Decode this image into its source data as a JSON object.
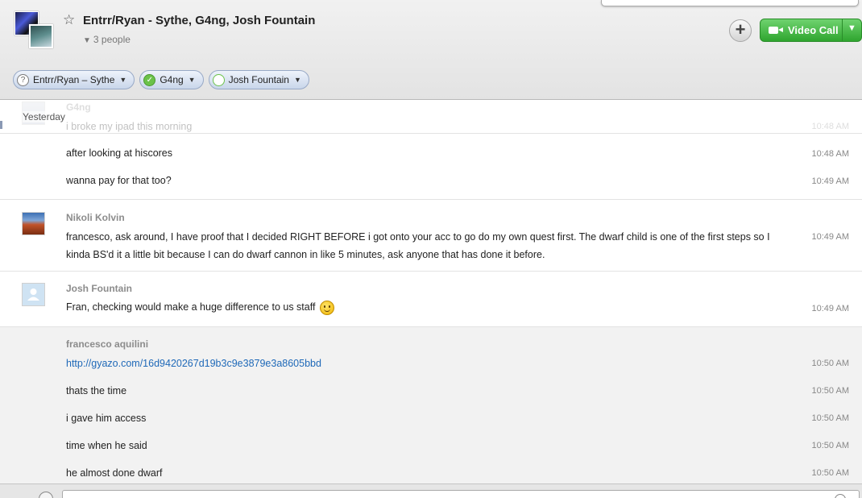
{
  "header": {
    "title": "Entrr/Ryan - Sythe, G4ng, Josh Fountain",
    "people_count": "3 people",
    "video_call_label": "Video Call",
    "add_label": "+",
    "participants": [
      {
        "name": "Entrr/Ryan – Sythe",
        "status": "unknown"
      },
      {
        "name": "G4ng",
        "status": "online"
      },
      {
        "name": "Josh Fountain",
        "status": "offline"
      }
    ]
  },
  "divider_label": "Yesterday",
  "blocks": [
    {
      "sender": "G4ng",
      "messages": [
        {
          "text": "i broke my ipad this morning",
          "time": "10:48 AM",
          "faded": true
        }
      ]
    },
    {
      "sender": "",
      "messages": [
        {
          "text": "after looking at hiscores",
          "time": "10:48 AM"
        },
        {
          "text": "wanna pay for that too?",
          "time": "10:49 AM"
        }
      ]
    },
    {
      "sender": "Nikoli Kolvin",
      "messages": [
        {
          "text": "francesco, ask around, I have proof that I decided RIGHT BEFORE i got onto your acc to go do my own quest first. The dwarf child is one of the first steps so I kinda BS'd it a little bit because I can do dwarf cannon in like 5 minutes, ask anyone that has done it before.",
          "time": "10:49 AM"
        }
      ]
    },
    {
      "sender": "Josh Fountain",
      "messages": [
        {
          "text": "Fran, checking would make a huge difference to us staff",
          "time": "10:49 AM",
          "emoji": "smiley-icon"
        }
      ]
    },
    {
      "sender": "francesco aquilini",
      "messages": [
        {
          "text": "http://gyazo.com/16d9420267d19b3c9e3879e3a8605bbd",
          "time": "10:50 AM",
          "link": true
        },
        {
          "text": "thats the time",
          "time": "10:50 AM"
        },
        {
          "text": "i gave him access",
          "time": "10:50 AM"
        },
        {
          "text": "time when he said",
          "time": "10:50 AM"
        },
        {
          "text": "he almost done dwarf",
          "time": "10:50 AM"
        }
      ]
    }
  ],
  "colors": {
    "accent_green": "#3db83d",
    "link_blue": "#1f69b8",
    "sender_grey": "#8c8c8c"
  }
}
